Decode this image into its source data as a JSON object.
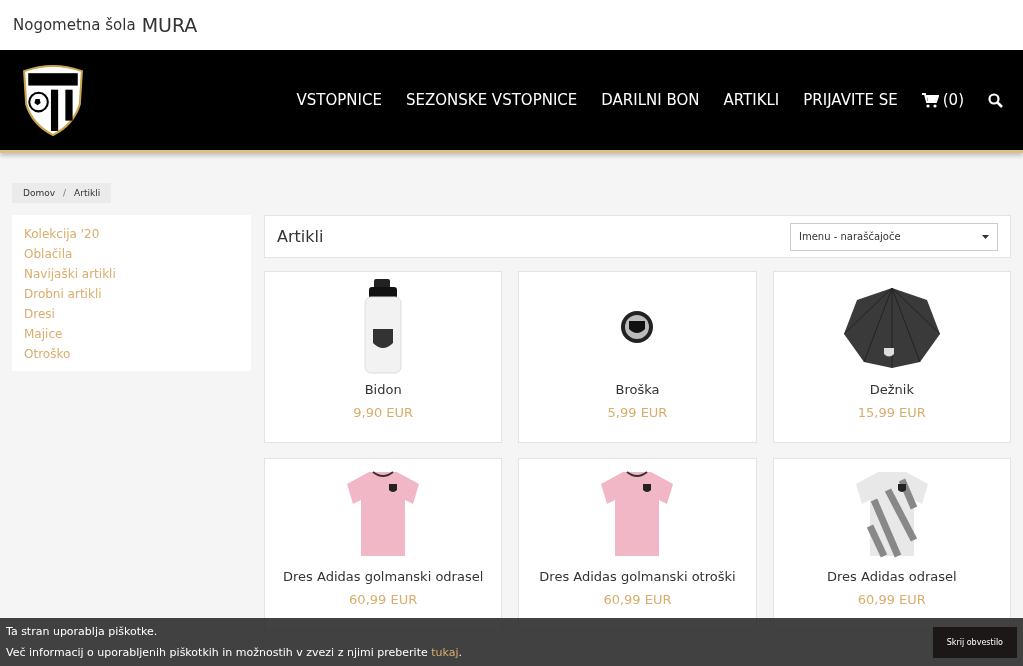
{
  "site_title": {
    "prefix": "Nogometna šola",
    "name": "MURA"
  },
  "nav": {
    "items": [
      "VSTOPNICE",
      "SEZONSKE VSTOPNICE",
      "DARILNI BON",
      "ARTIKLI",
      "PRIJAVITE SE"
    ],
    "cart": "(0)"
  },
  "breadcrumb": {
    "items": [
      "Domov",
      "Artikli"
    ],
    "separator": "/"
  },
  "sidebar": {
    "items": [
      "Kolekcija '20",
      "Oblačila",
      "Navijaški artikli",
      "Drobni artikli",
      "Dresi",
      "Majice",
      "Otroško"
    ]
  },
  "heading": "Artikli",
  "sort": {
    "value": "Imenu - naraščajoče"
  },
  "products": [
    {
      "kind": "bottle",
      "name": "Bidon",
      "price": "9,90 EUR"
    },
    {
      "kind": "pin",
      "name": "Broška",
      "price": "5,99 EUR"
    },
    {
      "kind": "umbrella",
      "name": "Dežnik",
      "price": "15,99 EUR"
    },
    {
      "kind": "jersey-pink",
      "name": "Dres Adidas golmanski odrasel",
      "price": "60,99 EUR"
    },
    {
      "kind": "jersey-pink",
      "name": "Dres Adidas golmanski otroški",
      "price": "60,99 EUR"
    },
    {
      "kind": "jersey-striped",
      "name": "Dres Adidas odrasel",
      "price": "60,99 EUR"
    }
  ],
  "cookie_bar": {
    "line1": "Ta stran uporablja piškotke.",
    "line2": "Več informacij o uporabljenih piškotkih in možnostih v zvezi z njimi preberite",
    "link": "tukaj",
    "after_link": ".",
    "button": "Skrij obvestilo"
  }
}
